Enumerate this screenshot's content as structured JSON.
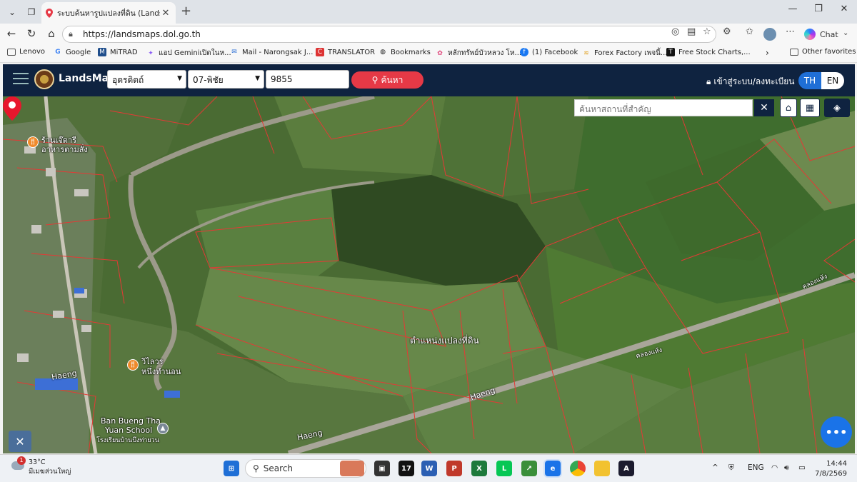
{
  "browser": {
    "tab_title": "ระบบค้นหารูปแปลงที่ดิน (LandsMaps)",
    "url": "https://landsmaps.dol.go.th",
    "chat_label": "Chat"
  },
  "favorites": [
    {
      "label": "Lenovo",
      "icon": "folder-icon"
    },
    {
      "label": "Google",
      "icon": "google-icon"
    },
    {
      "label": "MiTRAD",
      "icon": "mitrad-icon"
    },
    {
      "label": "แอป Geminiเปิดในห...",
      "icon": "gemini-icon"
    },
    {
      "label": "Mail - Narongsak J...",
      "icon": "mail-icon"
    },
    {
      "label": "TRANSLATOR",
      "icon": "translator-icon"
    },
    {
      "label": "Bookmarks",
      "icon": "globe-icon"
    },
    {
      "label": "หลักทรัพย์บัวหลวง โห...",
      "icon": "bualuang-icon"
    },
    {
      "label": "(1) Facebook",
      "icon": "facebook-icon"
    },
    {
      "label": "Forex Factory เพจนี้...",
      "icon": "forex-icon"
    },
    {
      "label": "Free Stock Charts,...",
      "icon": "tradingview-icon"
    },
    {
      "label": "Other favorites",
      "icon": "folder-icon"
    }
  ],
  "header": {
    "brand": "LandsMaps",
    "province": "อุตรดิตถ์",
    "district": "07-พิชัย",
    "parcel_number": "9855",
    "search_label": "ค้นหา",
    "login_label": "เข้าสู่ระบบ/ลงทะเบียน",
    "lang_th": "TH",
    "lang_en": "EN"
  },
  "map": {
    "place_search_placeholder": "ค้นหาสถานที่สำคัญ",
    "parcel_label": "ตำแหน่งแปลงที่ดิน",
    "labels": {
      "poi1_line1": "ร้านเจ๊ตารี",
      "poi1_line2": "อาหารตามสั่ง",
      "poi2_line1": "วิไลวร",
      "poi2_line2": "หนึ่งทำนอน",
      "school_line1": "Ban Bueng Tha",
      "school_line2": "Yuan School",
      "school_th": "โรงเรียนบ้านบึงท่ายวน",
      "road1": "Haeng",
      "road2": "Haeng",
      "road3": "Haeng",
      "road_th1": "คลองแห้ง",
      "road_th2": "คลองแห้ง"
    },
    "fab_label": "•••"
  },
  "taskbar": {
    "temp": "33°C",
    "weather_desc": "มีเมฆส่วนใหญ่",
    "weather_badge": "1",
    "search_label": "Search",
    "lang": "ENG",
    "time": "14:44",
    "date": "7/8/2569"
  }
}
